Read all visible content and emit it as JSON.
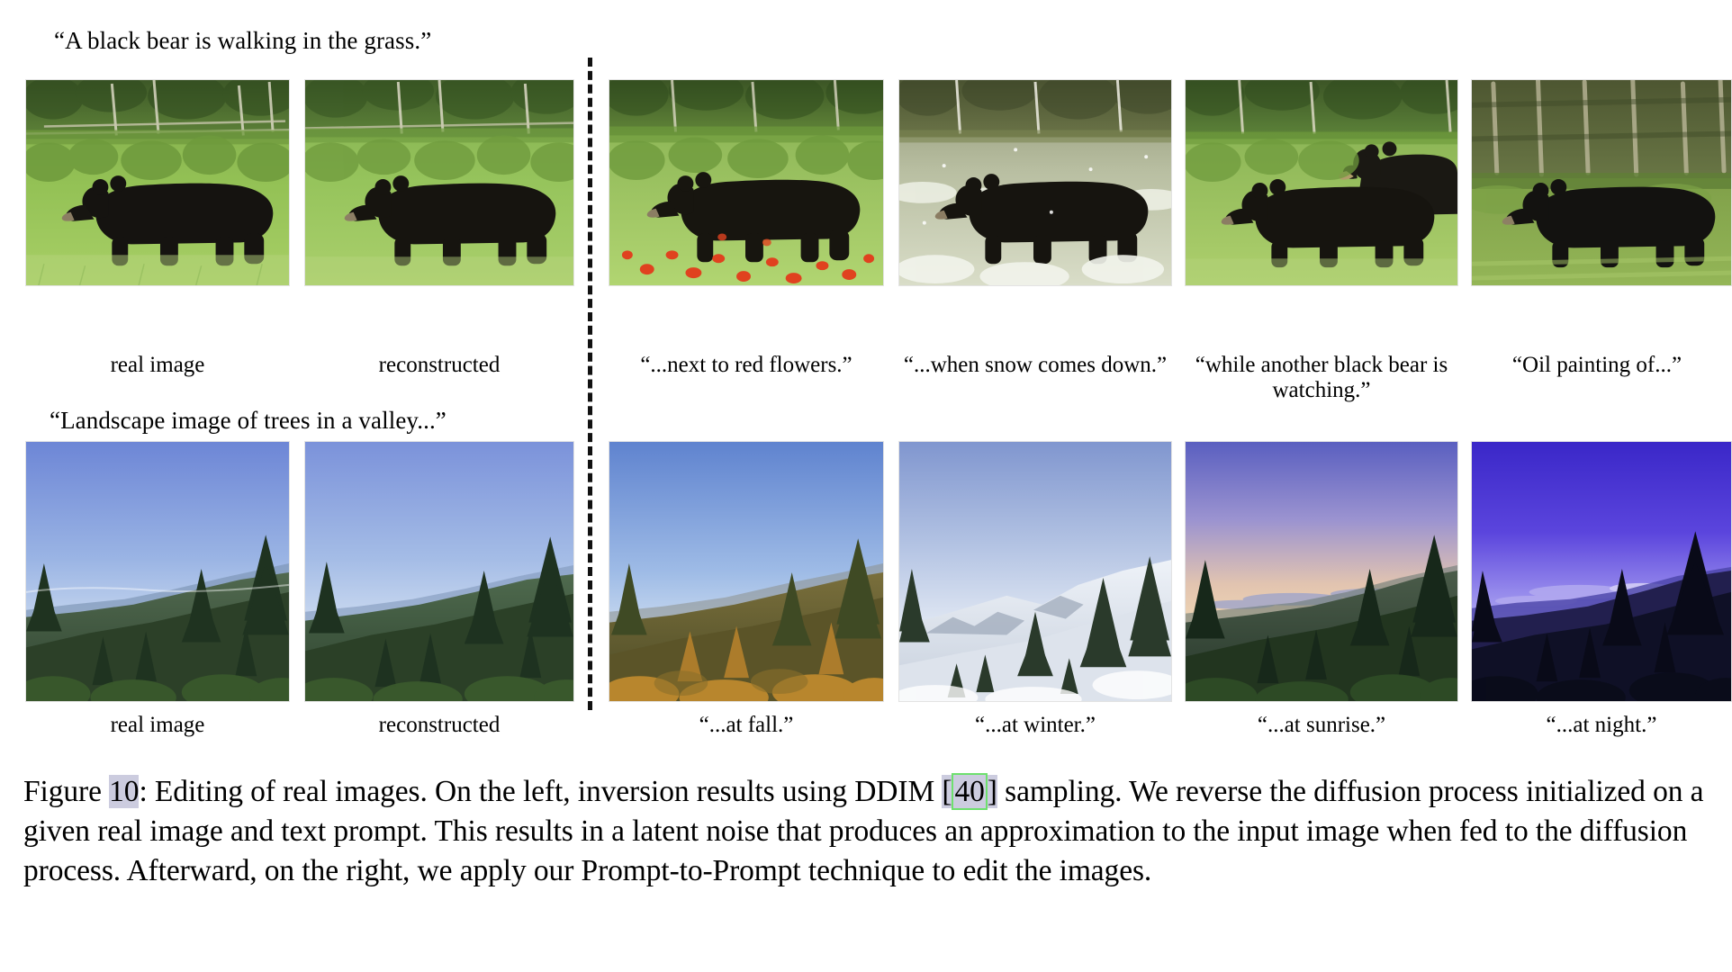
{
  "figure": {
    "number": "10",
    "caption_prefix": "Figure ",
    "caption_after_number": ": Editing of real images. On the left, inversion results using DDIM ",
    "reference": "40",
    "ref_open": "[",
    "ref_close": "]",
    "caption_rest": " sampling. We reverse the diffusion process initialized on a given real image and text prompt. This results in a latent noise that produces an approximation to the input image when fed to the diffusion process. Afterward, on the right, we apply our Prompt-to-Prompt technique to edit the images.",
    "highlight_color": "#ccccdf",
    "ref_border_color": "#6ee06e"
  },
  "rows": [
    {
      "id": "bear-row",
      "prompt": "“A black bear is walking in the grass.”",
      "left_cells": [
        {
          "name": "real-image",
          "caption": "real image"
        },
        {
          "name": "reconstructed",
          "caption": "reconstructed"
        }
      ],
      "right_cells": [
        {
          "name": "edit-red-flowers",
          "caption": "“...next to red flowers.”"
        },
        {
          "name": "edit-snow-comes-down",
          "caption": "“...when snow comes down.”"
        },
        {
          "name": "edit-another-bear",
          "caption": "“while another black bear is watching.”"
        },
        {
          "name": "edit-oil-painting",
          "caption": "“Oil painting of...”"
        }
      ]
    },
    {
      "id": "landscape-row",
      "prompt": "“Landscape image of trees in a valley...”",
      "left_cells": [
        {
          "name": "real-image",
          "caption": "real image"
        },
        {
          "name": "reconstructed",
          "caption": "reconstructed"
        }
      ],
      "right_cells": [
        {
          "name": "edit-fall",
          "caption": "“...at fall.”"
        },
        {
          "name": "edit-winter",
          "caption": "“...at winter.”"
        },
        {
          "name": "edit-sunrise",
          "caption": "“...at sunrise.”"
        },
        {
          "name": "edit-night",
          "caption": "“...at night.”"
        }
      ]
    }
  ]
}
